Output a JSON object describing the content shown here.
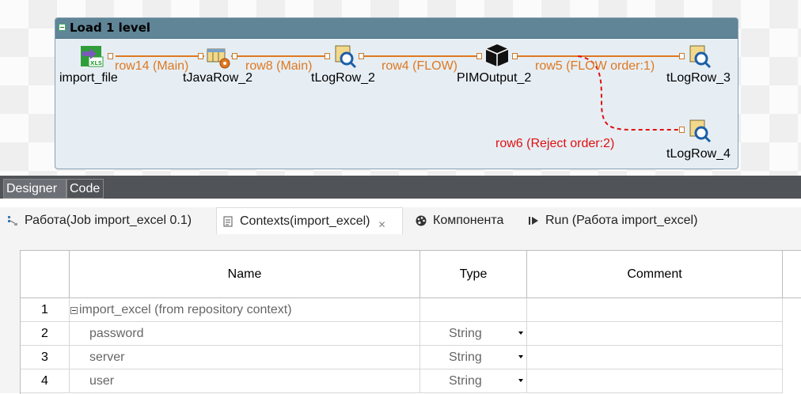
{
  "subjob": {
    "title": "Load 1 level"
  },
  "components": [
    {
      "label": "import_file",
      "icon": "xls-input-icon"
    },
    {
      "label": "tJavaRow_2",
      "icon": "java-row-icon"
    },
    {
      "label": "tLogRow_2",
      "icon": "log-row-icon"
    },
    {
      "label": "PIMOutput_2",
      "icon": "cube-output-icon"
    },
    {
      "label": "tLogRow_3",
      "icon": "log-row-icon"
    },
    {
      "label": "tLogRow_4",
      "icon": "log-row-icon"
    }
  ],
  "links": [
    {
      "label": "row14 (Main)",
      "color": "#e07820"
    },
    {
      "label": "row8 (Main)",
      "color": "#e07820"
    },
    {
      "label": "row4 (FLOW)",
      "color": "#e07820"
    },
    {
      "label": "row5 (FLOW order:1)",
      "color": "#e07820"
    },
    {
      "label": "row6 (Reject order:2)",
      "color": "#e01010"
    }
  ],
  "editor_tabs": {
    "designer": "Designer",
    "code": "Code"
  },
  "view_tabs": [
    {
      "label": "Работа(Job import_excel 0.1)",
      "icon": "job-icon"
    },
    {
      "label": "Contexts(import_excel)",
      "icon": "contexts-icon",
      "active": true
    },
    {
      "label": "Компонента",
      "icon": "palette-icon"
    },
    {
      "label": "Run (Работа import_excel)",
      "icon": "run-icon"
    }
  ],
  "table": {
    "headers": {
      "name": "Name",
      "type": "Type",
      "comment": "Comment"
    },
    "rows": [
      {
        "num": "1",
        "name": "import_excel (from repository context)",
        "type": "",
        "comment": ""
      },
      {
        "num": "2",
        "name": "password",
        "type": "String",
        "comment": ""
      },
      {
        "num": "3",
        "name": "server",
        "type": "String",
        "comment": ""
      },
      {
        "num": "4",
        "name": "user",
        "type": "String",
        "comment": ""
      }
    ]
  }
}
